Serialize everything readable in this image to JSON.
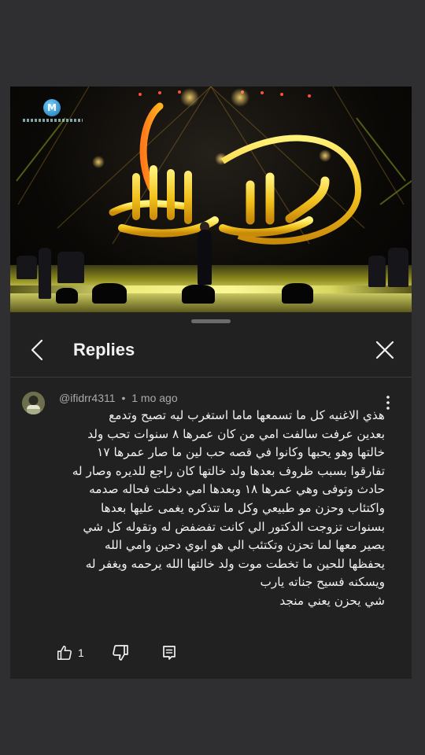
{
  "video": {
    "channel_logo_letter": "M",
    "stage_title_art": "راشد الماجد"
  },
  "replies_panel": {
    "title": "Replies",
    "icons": {
      "back": "chevron-left-icon",
      "close": "close-icon",
      "more": "more-vert-icon",
      "like": "thumb-up-icon",
      "dislike": "thumb-down-icon",
      "reply": "reply-comment-icon"
    },
    "comment": {
      "author": "@ifidrr4311",
      "separator": "•",
      "time": "1 mo ago",
      "lines": [
        "هذي الاغنيه كل ما تسمعها ماما استغرب ليه تصيح وتدمع",
        "بعدين عرفت سالفت امي من كان عمرها ٨ سنوات تحب ولد",
        "خالتها وهو يحبها وكانوا في قصه حب لين ما صار عمرها ١٧",
        "تفارقوا بسبب ظروف بعدها ولد خالتها كان راجع للديره وصار له",
        "حادث وتوفى وهي عمرها ١٨ وبعدها امي دخلت فحاله صدمه",
        "واكتئاب وحزن مو طبيعي وكل ما تتذكره يغمى عليها  بعدها",
        "بسنوات تزوجت الدكتور الي كانت تفضفض له وتقوله كل شي",
        "يصير معها لما تحزن وتكتئب الي هو ابوي دحين وامي الله",
        "يحفظها للحين ما تخطت موت ولد خالتها الله يرحمه ويغفر له",
        "ويسكنه فسيح جناته يارب",
        "شي يحزن يعني منجد"
      ],
      "like_count": "1"
    }
  }
}
